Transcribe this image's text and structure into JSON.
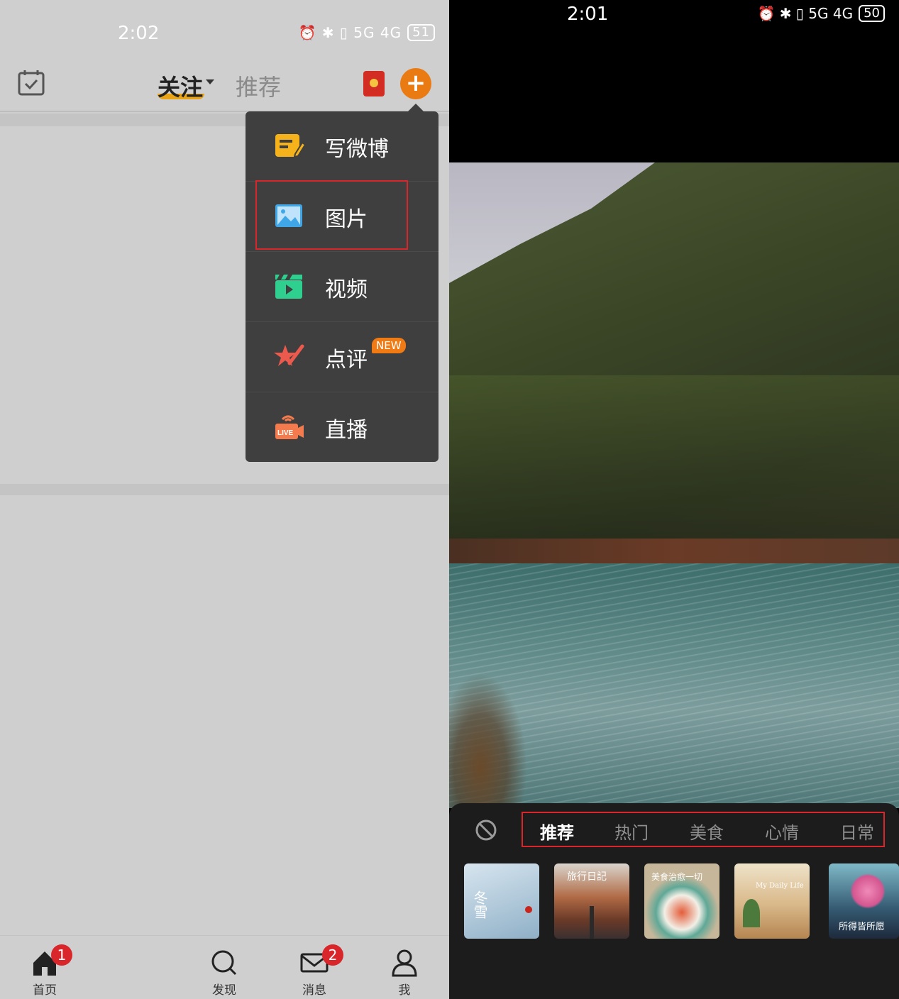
{
  "left": {
    "status": {
      "time": "2:02",
      "icons": "⏰ ✱ ▯ 5G 4G",
      "battery": "51"
    },
    "topbar": {
      "tab_follow": "关注",
      "tab_recommend": "推荐",
      "plus": "+"
    },
    "menu": [
      {
        "label": "写微博",
        "icon": "edit-note-icon"
      },
      {
        "label": "图片",
        "icon": "image-icon"
      },
      {
        "label": "视频",
        "icon": "video-clapper-icon"
      },
      {
        "label": "点评",
        "icon": "star-review-icon"
      },
      {
        "label": "直播",
        "icon": "live-camera-icon"
      }
    ],
    "new_badge": "NEW",
    "bottom_nav": [
      {
        "label": "首页",
        "icon": "home-icon",
        "badge": "1"
      },
      {
        "label": "发现",
        "icon": "search-icon",
        "badge": ""
      },
      {
        "label": "消息",
        "icon": "mail-icon",
        "badge": "2"
      },
      {
        "label": "我",
        "icon": "person-icon",
        "badge": ""
      }
    ]
  },
  "right": {
    "status": {
      "time": "2:01",
      "icons": "⏰ ✱ ▯ 5G 4G",
      "battery": "50"
    },
    "filter_tabs": [
      "推荐",
      "热门",
      "美食",
      "心情",
      "日常"
    ],
    "active_tab": "推荐",
    "thumbnails": [
      {
        "text": "冬雪",
        "color": "#a9c3d4"
      },
      {
        "text": "旅行日記",
        "color": "#8a4b36"
      },
      {
        "text": "美食治愈一切",
        "color": "#c6b596"
      },
      {
        "text": "My Daily Life",
        "color": "#d8b88a"
      },
      {
        "text": "所得皆所愿",
        "color": "#2a3b52"
      }
    ]
  },
  "colors": {
    "accent_orange": "#ea7a12",
    "highlight_red": "#d8262a",
    "menu_bg": "#3f3f3f"
  }
}
